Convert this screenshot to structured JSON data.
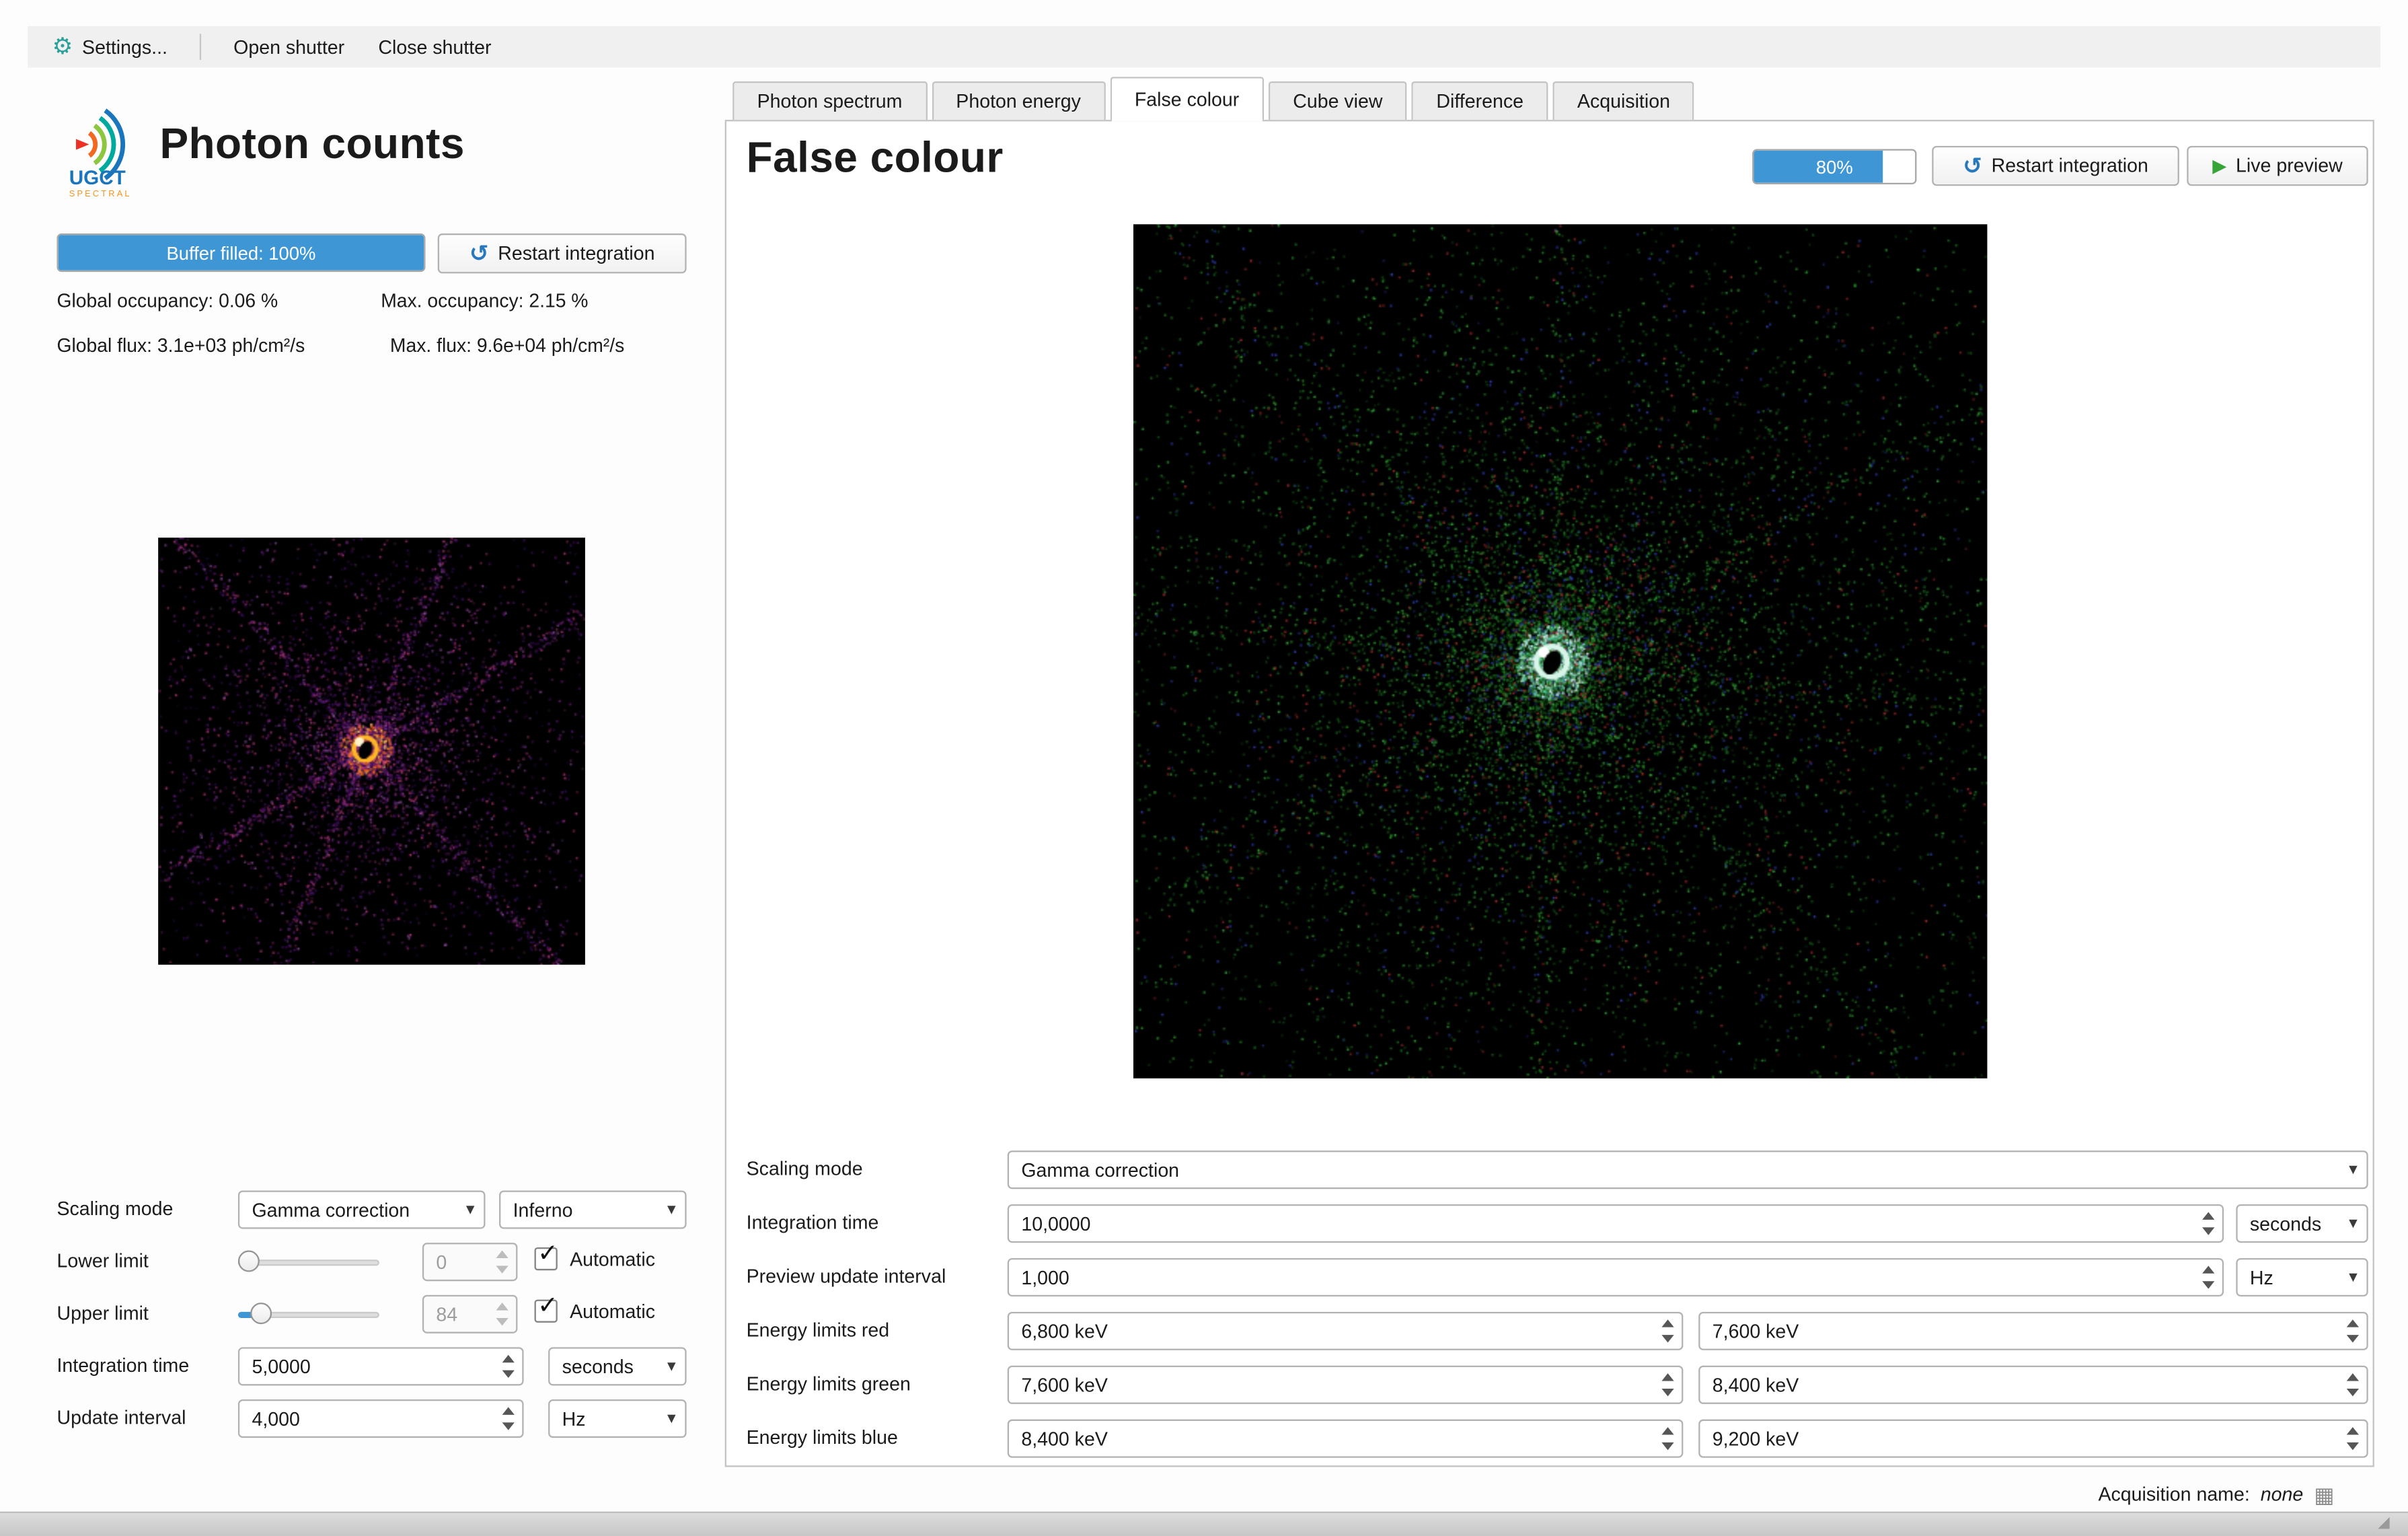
{
  "menubar": {
    "settings": "Settings...",
    "open_shutter": "Open shutter",
    "close_shutter": "Close shutter"
  },
  "left_panel": {
    "logo_title": "UGCT",
    "logo_subtitle": "SPECTRAL",
    "title": "Photon counts",
    "buffer_label": "Buffer filled: 100%",
    "buffer_percent": 100,
    "restart_label": "Restart integration",
    "stats": {
      "global_occupancy": "Global occupancy: 0.06 %",
      "max_occupancy": "Max. occupancy: 2.15 %",
      "global_flux": "Global flux: 3.1e+03 ph/cm²/s",
      "max_flux": "Max. flux: 9.6e+04 ph/cm²/s"
    },
    "controls": {
      "scaling_mode": {
        "label": "Scaling mode",
        "value": "Gamma correction",
        "colormap": "Inferno"
      },
      "lower_limit": {
        "label": "Lower limit",
        "value": "0",
        "automatic_label": "Automatic",
        "automatic_checked": true
      },
      "upper_limit": {
        "label": "Upper limit",
        "value": "84",
        "automatic_label": "Automatic",
        "automatic_checked": true
      },
      "integration_time": {
        "label": "Integration time",
        "value": "5,0000",
        "unit": "seconds"
      },
      "update_interval": {
        "label": "Update interval",
        "value": "4,000",
        "unit": "Hz"
      }
    }
  },
  "right_panel": {
    "tabs": [
      {
        "label": "Photon spectrum",
        "active": false
      },
      {
        "label": "Photon energy",
        "active": false
      },
      {
        "label": "False colour",
        "active": true
      },
      {
        "label": "Cube view",
        "active": false
      },
      {
        "label": "Difference",
        "active": false
      },
      {
        "label": "Acquisition",
        "active": false
      }
    ],
    "title": "False colour",
    "progress_label": "80%",
    "progress_percent": 80,
    "restart_label": "Restart integration",
    "live_preview_label": "Live preview",
    "controls": {
      "scaling_mode": {
        "label": "Scaling mode",
        "value": "Gamma correction"
      },
      "integration_time": {
        "label": "Integration time",
        "value": "10,0000",
        "unit": "seconds"
      },
      "preview_update_interval": {
        "label": "Preview update interval",
        "value": "1,000",
        "unit": "Hz"
      },
      "energy_limits_red": {
        "label": "Energy limits red",
        "low": "6,800 keV",
        "high": "7,600 keV"
      },
      "energy_limits_green": {
        "label": "Energy limits green",
        "low": "7,600 keV",
        "high": "8,400 keV"
      },
      "energy_limits_blue": {
        "label": "Energy limits blue",
        "low": "8,400 keV",
        "high": "9,200 keV"
      }
    }
  },
  "statusbar": {
    "acquisition_label": "Acquisition name:",
    "acquisition_value": "none"
  },
  "icons": {
    "gear": "⚙",
    "restart_arrow": "↺",
    "play": "▶",
    "dropdown_arrow": "▾",
    "checkmark": "✓",
    "table": "▦",
    "resize_grip": "◢"
  },
  "colors": {
    "accent_blue": "#3e97d4",
    "gear_icon": "#2aa198",
    "restart_icon": "#2878be",
    "play_icon": "#36a436",
    "logo_blue": "#1b75bc",
    "logo_orange": "#f7941d",
    "image_background": "#000000"
  }
}
